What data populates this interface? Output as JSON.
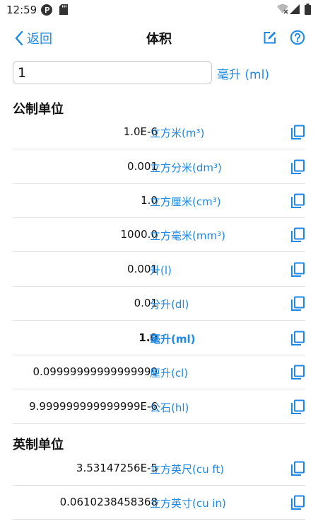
{
  "status_bar": {
    "time": "12:59",
    "icons": [
      "app-notification-icon",
      "sd-card-icon",
      "wifi-icon",
      "signal-icon",
      "battery-icon"
    ]
  },
  "top_bar": {
    "back_label": "返回",
    "title": "体积",
    "icons": [
      "chevron-left-icon",
      "edit-icon",
      "help-icon"
    ]
  },
  "input": {
    "value": "1",
    "unit": "毫升 (ml)"
  },
  "colors": {
    "accent": "#1e88e5",
    "divider": "#e2e2e2",
    "text": "#111111"
  },
  "sections": [
    {
      "title": "公制单位",
      "rows": [
        {
          "value": "1.0E-6",
          "unit": "立方米(m³)"
        },
        {
          "value": "0.001",
          "unit": "立方分米(dm³)"
        },
        {
          "value": "1.0",
          "unit": "立方厘米(cm³)"
        },
        {
          "value": "1000.0",
          "unit": "立方毫米(mm³)"
        },
        {
          "value": "0.001",
          "unit": "升(l)"
        },
        {
          "value": "0.01",
          "unit": "分升(dl)"
        },
        {
          "value": "1.0",
          "unit": "毫升(ml)",
          "selected": true
        },
        {
          "value": "0.09999999999999999",
          "unit": "厘升(cl)"
        },
        {
          "value": "9.999999999999999E-6",
          "unit": "公石(hl)"
        }
      ]
    },
    {
      "title": "英制单位",
      "rows": [
        {
          "value": "3.53147256E-5",
          "unit": "立方英尺(cu ft)"
        },
        {
          "value": "0.0610238458368",
          "unit": "立方英寸(cu in)"
        }
      ]
    }
  ]
}
